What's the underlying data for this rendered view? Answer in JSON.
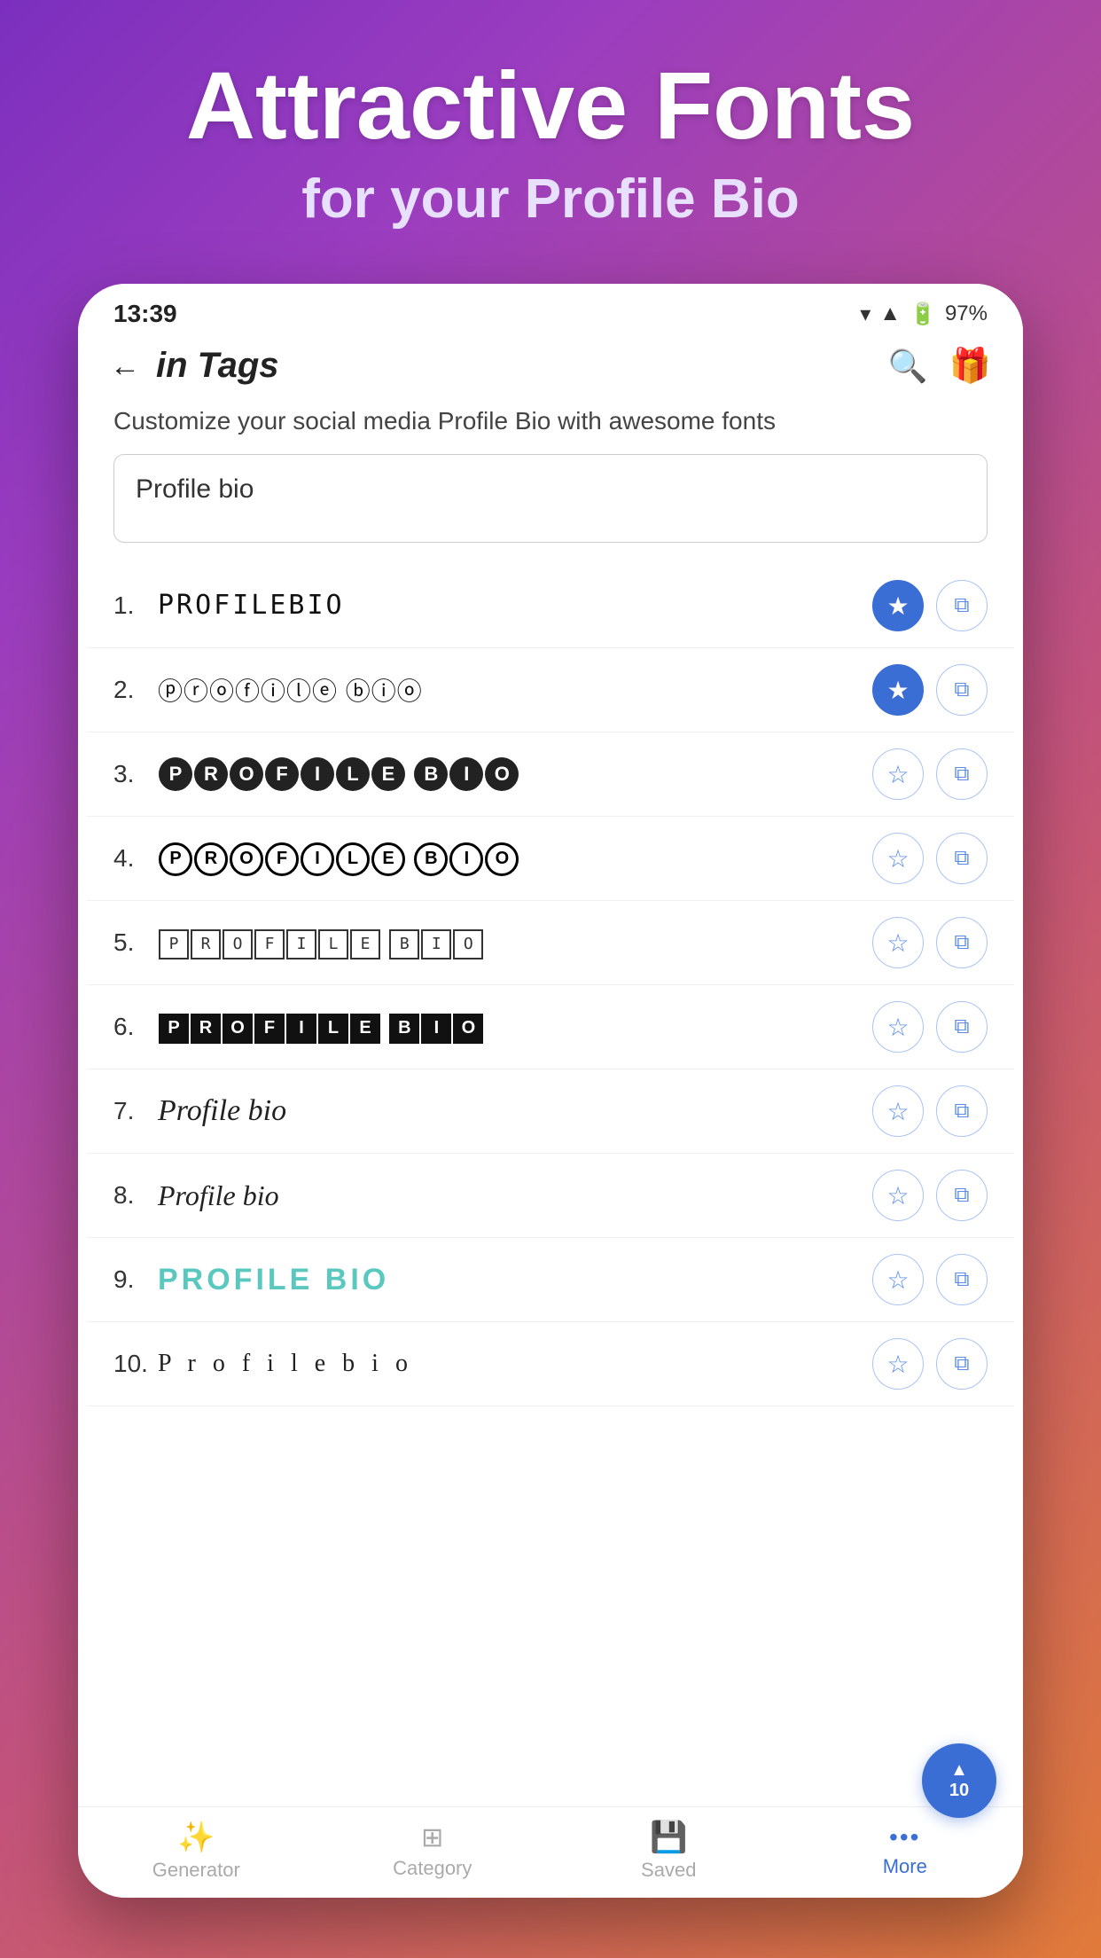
{
  "hero": {
    "title_line1": "Attractive Fonts",
    "title_line2": "for your Profile Bio"
  },
  "status_bar": {
    "time": "13:39",
    "battery": "97%",
    "wifi": "▼",
    "signal": "▲"
  },
  "app_bar": {
    "back_label": "←",
    "title": "in Tags",
    "search_label": "🔍",
    "gift_label": "🎁"
  },
  "subtitle": "Customize your social media Profile Bio with awesome fonts",
  "input": {
    "value": "Profile bio",
    "placeholder": "Profile bio"
  },
  "font_items": [
    {
      "number": "1.",
      "preview": "𝙿𝚁𝙾𝙵𝙸𝙻𝙴𝙱𝙸𝙾",
      "style": "japanese",
      "starred": true
    },
    {
      "number": "2.",
      "preview": "ⓟⓡⓞⓕⓘⓛⓔ ⓑⓘⓞ",
      "style": "circle",
      "starred": true
    },
    {
      "number": "3.",
      "preview": "PROFILE BIO",
      "style": "bubble-white",
      "starred": false
    },
    {
      "number": "4.",
      "preview": "PROFILE BIO",
      "style": "bubble-black",
      "starred": false
    },
    {
      "number": "5.",
      "preview": "PROFILE BIO",
      "style": "boxed",
      "starred": false
    },
    {
      "number": "6.",
      "preview": "PROFILE BIO",
      "style": "bold-inverse",
      "starred": false
    },
    {
      "number": "7.",
      "preview": "Profile bio",
      "style": "script1",
      "starred": false
    },
    {
      "number": "8.",
      "preview": "Profile bio",
      "style": "script2",
      "starred": false
    },
    {
      "number": "9.",
      "preview": "PROFILE BIO",
      "style": "teal",
      "starred": false
    },
    {
      "number": "10.",
      "preview": "P r o f i l e b i o",
      "style": "spaced",
      "starred": false
    }
  ],
  "scroll_btn": {
    "icon": "▲",
    "label": "10"
  },
  "bottom_nav": {
    "items": [
      {
        "id": "generator",
        "label": "Generator",
        "icon": "✨",
        "active": false
      },
      {
        "id": "category",
        "label": "Category",
        "icon": "⊞",
        "active": false
      },
      {
        "id": "saved",
        "label": "Saved",
        "icon": "💾",
        "active": false
      },
      {
        "id": "more",
        "label": "More",
        "icon": "•••",
        "active": true
      }
    ]
  }
}
